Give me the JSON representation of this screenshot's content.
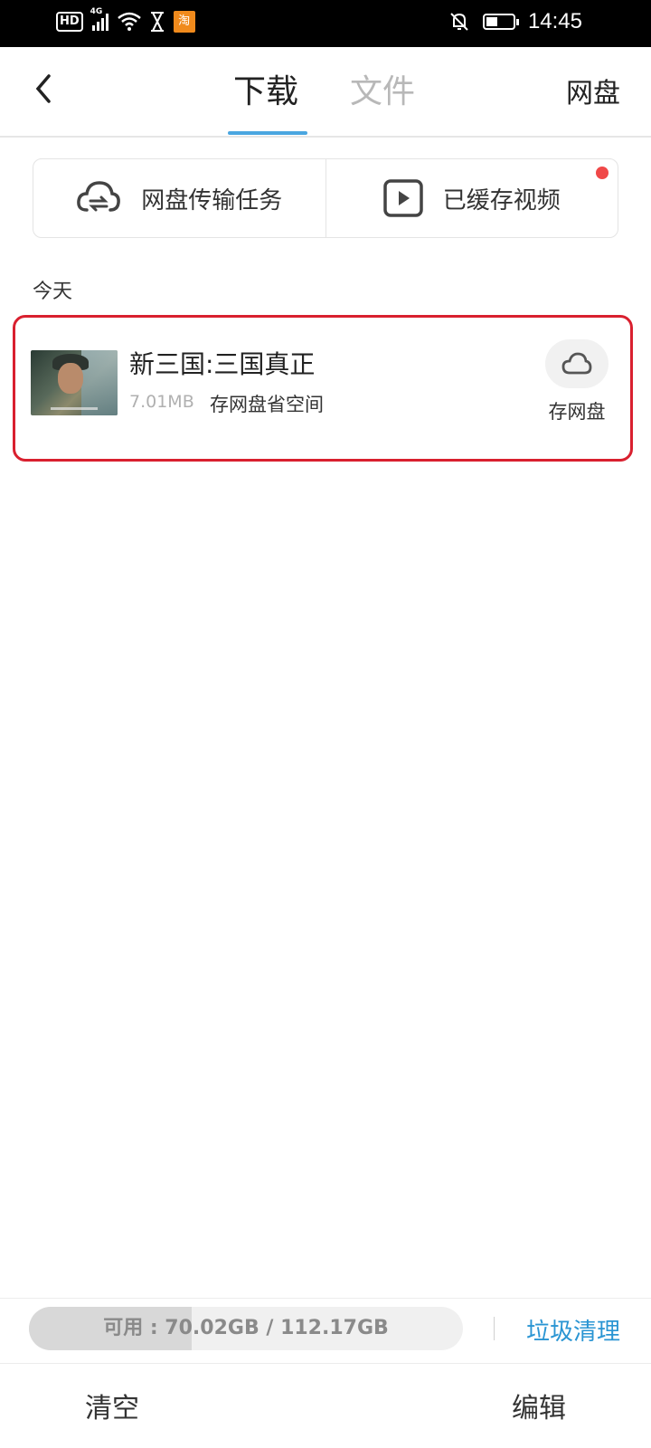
{
  "status_bar": {
    "hd": "HD",
    "network": "4G",
    "app_badge": "淘",
    "time": "14:45"
  },
  "header": {
    "tabs": [
      {
        "label": "下载",
        "active": true
      },
      {
        "label": "文件",
        "active": false
      }
    ],
    "right_link": "网盘",
    "accent_color": "#4aa6e0"
  },
  "quick_cards": [
    {
      "label": "网盘传输任务",
      "icon": "cloud-transfer-icon"
    },
    {
      "label": "已缓存视频",
      "icon": "video-play-icon",
      "has_dot": true
    }
  ],
  "section": {
    "title": "今天"
  },
  "items": [
    {
      "title": "新三国:三国真正",
      "size": "7.01MB",
      "note": "存网盘省空间",
      "action_label": "存网盘",
      "highlight_color": "#d9202f"
    }
  ],
  "storage": {
    "text": "可用 : 70.02GB / 112.17GB",
    "available_gb": 70.02,
    "total_gb": 112.17,
    "used_fraction": 0.376,
    "clean_label": "垃圾清理",
    "link_color": "#2a95d3"
  },
  "bottom_bar": {
    "clear_label": "清空",
    "edit_label": "编辑"
  }
}
